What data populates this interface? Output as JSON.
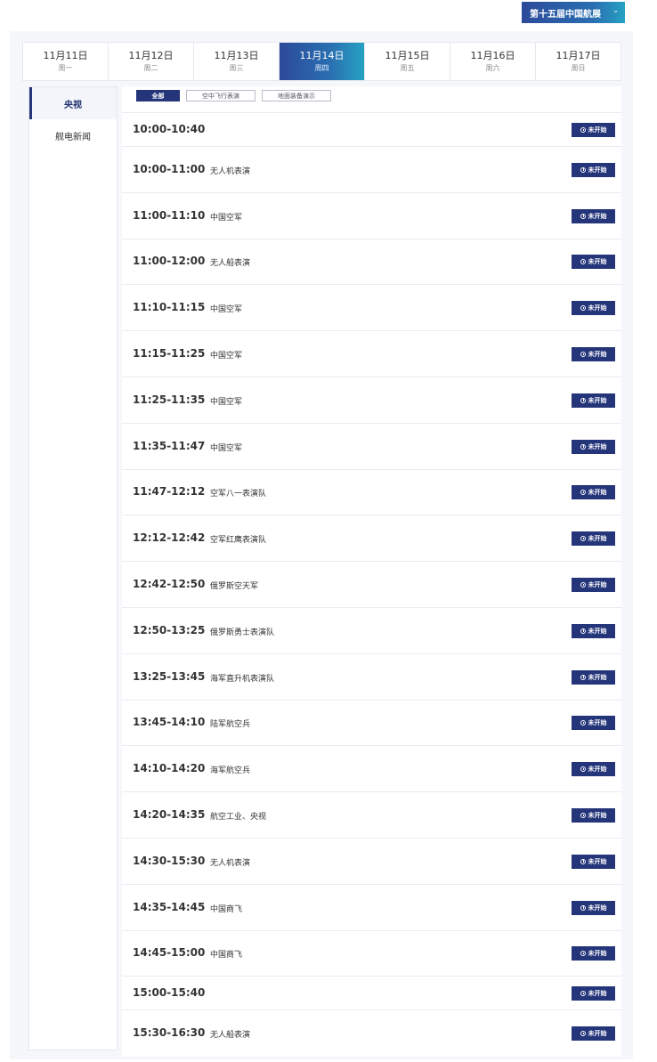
{
  "event_select": {
    "label": "第十五届中国航展",
    "icon": "chevron-down-icon"
  },
  "dates": [
    {
      "date": "11月11日",
      "weekday": "周一",
      "active": false
    },
    {
      "date": "11月12日",
      "weekday": "周二",
      "active": false
    },
    {
      "date": "11月13日",
      "weekday": "周三",
      "active": false
    },
    {
      "date": "11月14日",
      "weekday": "周四",
      "active": true
    },
    {
      "date": "11月15日",
      "weekday": "周五",
      "active": false
    },
    {
      "date": "11月16日",
      "weekday": "周六",
      "active": false
    },
    {
      "date": "11月17日",
      "weekday": "周日",
      "active": false
    }
  ],
  "sidebar": {
    "items": [
      {
        "label": "央视",
        "active": true
      },
      {
        "label": "舰电新闻",
        "active": false
      }
    ]
  },
  "filters": [
    {
      "label": "全部",
      "active": true
    },
    {
      "label": "空中飞行表演",
      "active": false
    },
    {
      "label": "地面装备演示",
      "active": false
    }
  ],
  "schedule": [
    {
      "time": "10:00-10:40",
      "name": "",
      "status": "未开始"
    },
    {
      "time": "10:00-11:00",
      "name": "无人机表演",
      "status": "未开始"
    },
    {
      "time": "11:00-11:10",
      "name": "中国空军",
      "status": "未开始"
    },
    {
      "time": "11:00-12:00",
      "name": "无人船表演",
      "status": "未开始"
    },
    {
      "time": "11:10-11:15",
      "name": "中国空军",
      "status": "未开始"
    },
    {
      "time": "11:15-11:25",
      "name": "中国空军",
      "status": "未开始"
    },
    {
      "time": "11:25-11:35",
      "name": "中国空军",
      "status": "未开始"
    },
    {
      "time": "11:35-11:47",
      "name": "中国空军",
      "status": "未开始"
    },
    {
      "time": "11:47-12:12",
      "name": "空军八一表演队",
      "status": "未开始"
    },
    {
      "time": "12:12-12:42",
      "name": "空军红鹰表演队",
      "status": "未开始"
    },
    {
      "time": "12:42-12:50",
      "name": "俄罗斯空天军",
      "status": "未开始"
    },
    {
      "time": "12:50-13:25",
      "name": "俄罗斯勇士表演队",
      "status": "未开始"
    },
    {
      "time": "13:25-13:45",
      "name": "海军直升机表演队",
      "status": "未开始"
    },
    {
      "time": "13:45-14:10",
      "name": "陆军航空兵",
      "status": "未开始"
    },
    {
      "time": "14:10-14:20",
      "name": "海军航空兵",
      "status": "未开始"
    },
    {
      "time": "14:20-14:35",
      "name": "航空工业、央视",
      "status": "未开始"
    },
    {
      "time": "14:30-15:30",
      "name": "无人机表演",
      "status": "未开始"
    },
    {
      "time": "14:35-14:45",
      "name": "中国商飞",
      "status": "未开始"
    },
    {
      "time": "14:45-15:00",
      "name": "中国商飞",
      "status": "未开始"
    },
    {
      "time": "15:00-15:40",
      "name": "",
      "status": "未开始"
    },
    {
      "time": "15:30-16:30",
      "name": "无人船表演",
      "status": "未开始"
    }
  ],
  "colors": {
    "accent": "#24357a",
    "gradient_end": "#25a2c3"
  }
}
